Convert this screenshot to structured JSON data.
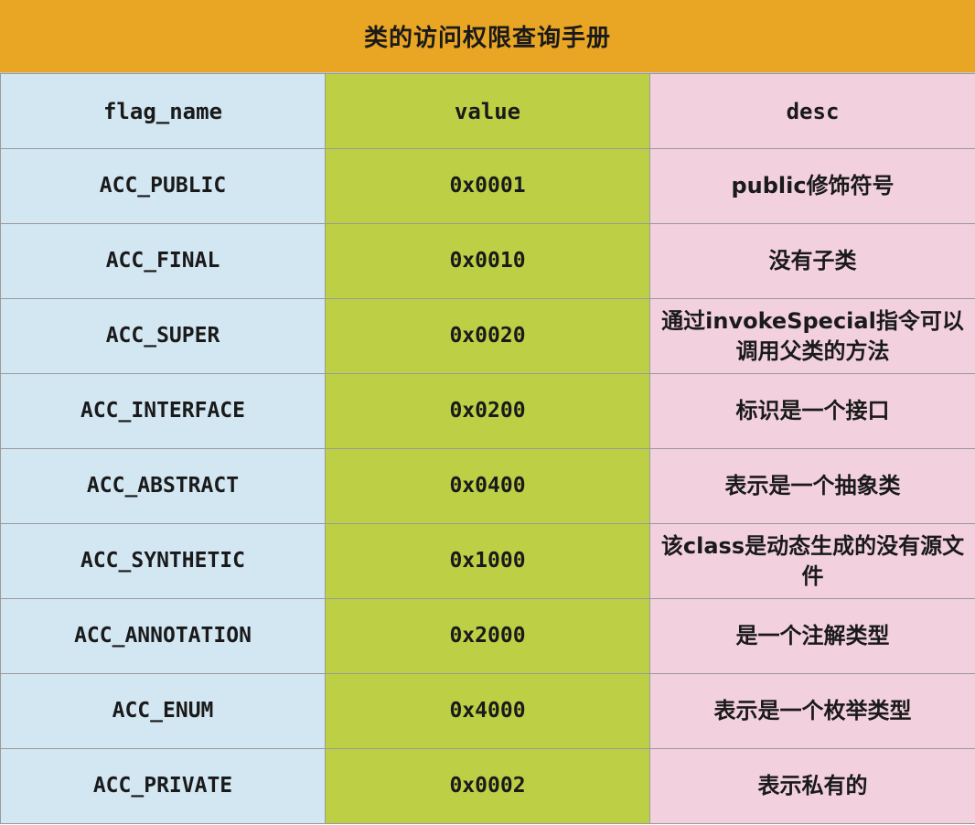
{
  "title": "类的访问权限查询手册",
  "columns": [
    "flag_name",
    "value",
    "desc"
  ],
  "colors": {
    "title_bg": "#E9A524",
    "name_bg": "#D3E7F3",
    "value_bg": "#BDD045",
    "desc_bg": "#F2D0DE"
  },
  "rows": [
    {
      "flag_name": "ACC_PUBLIC",
      "value": "0x0001",
      "desc": "public修饰符号"
    },
    {
      "flag_name": "ACC_FINAL",
      "value": "0x0010",
      "desc": "没有子类"
    },
    {
      "flag_name": "ACC_SUPER",
      "value": "0x0020",
      "desc": "通过invokeSpecial指令可以调用父类的方法"
    },
    {
      "flag_name": "ACC_INTERFACE",
      "value": "0x0200",
      "desc": "标识是一个接口"
    },
    {
      "flag_name": "ACC_ABSTRACT",
      "value": "0x0400",
      "desc": "表示是一个抽象类"
    },
    {
      "flag_name": "ACC_SYNTHETIC",
      "value": "0x1000",
      "desc": "该class是动态生成的没有源文件"
    },
    {
      "flag_name": "ACC_ANNOTATION",
      "value": "0x2000",
      "desc": "是一个注解类型"
    },
    {
      "flag_name": "ACC_ENUM",
      "value": "0x4000",
      "desc": "表示是一个枚举类型"
    },
    {
      "flag_name": "ACC_PRIVATE",
      "value": "0x0002",
      "desc": "表示私有的"
    }
  ]
}
